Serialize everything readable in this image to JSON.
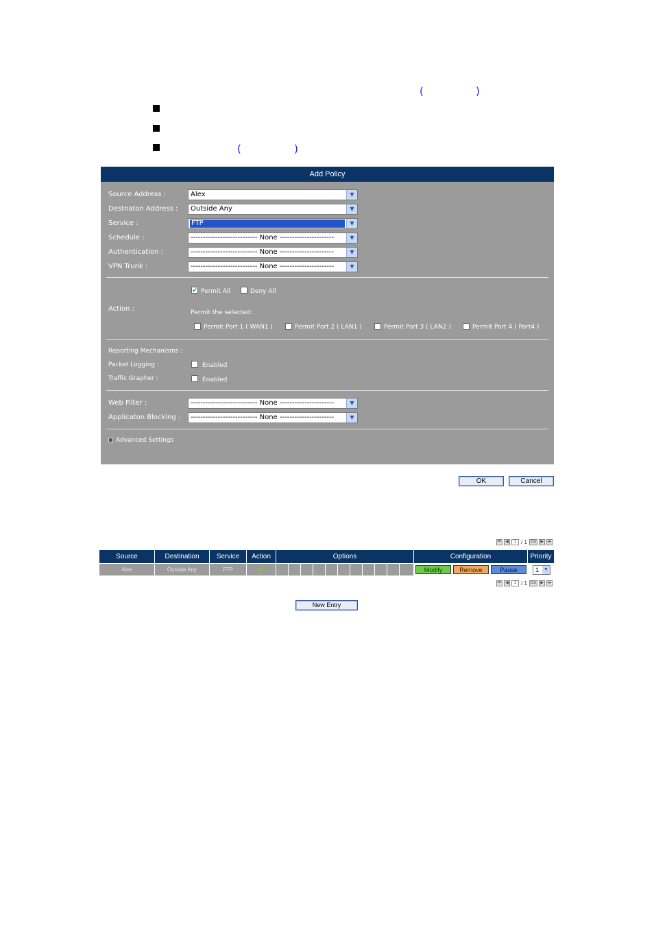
{
  "doc": {
    "bullets": [
      "",
      "",
      ""
    ]
  },
  "panel": {
    "title": "Add Policy",
    "fields": [
      {
        "label": "Source Address :",
        "value": "Alex"
      },
      {
        "label": "Destnaton Address :",
        "value": "Outside Any"
      },
      {
        "label": "Service :",
        "value": "FTP"
      },
      {
        "label": "Schedule :",
        "value": "--------------------------- None ----------------------"
      },
      {
        "label": "Authentication :",
        "value": "--------------------------- None ----------------------"
      },
      {
        "label": "VPN Trunk :",
        "value": "--------------------------- None ----------------------"
      }
    ],
    "action": {
      "label": "Action :",
      "permit_all": "Permit All",
      "deny_all": "Deny All",
      "permit_selected": "Permit the selected:",
      "ports": [
        "Permit Port  1 ( WAN1 )",
        "Permit Port  2 ( LAN1 )",
        "Permit Port  3 ( LAN2 )",
        "Permit Port  4 ( Port4 )"
      ]
    },
    "reporting": {
      "label": "Reporting Mechanisms :",
      "packet_logging": "Packet Logging :",
      "traffic_grapher": "Traffic Grapher :",
      "enabled": "Enabled"
    },
    "web_filter": {
      "label": "Web Filter :",
      "value": "--------------------------- None ----------------------"
    },
    "app_blocking": {
      "label": "Applicaton Blocking :",
      "value": "--------------------------- None ----------------------"
    },
    "advanced": "Advanced Settings"
  },
  "buttons": {
    "ok": "OK",
    "cancel": "Cancel",
    "new_entry": "New Entry"
  },
  "pager": {
    "page": "1",
    "total": "/ 1",
    "go": "Go"
  },
  "table": {
    "headers": [
      "Source",
      "Destination",
      "Service",
      "Action",
      "Options",
      "Configuration",
      "Priority"
    ],
    "row": {
      "source": "Alex",
      "destination": "Outside Any",
      "service": "FTP",
      "modify": "Modify",
      "remove": "Remove",
      "pause": "Pause",
      "priority": "1"
    }
  }
}
